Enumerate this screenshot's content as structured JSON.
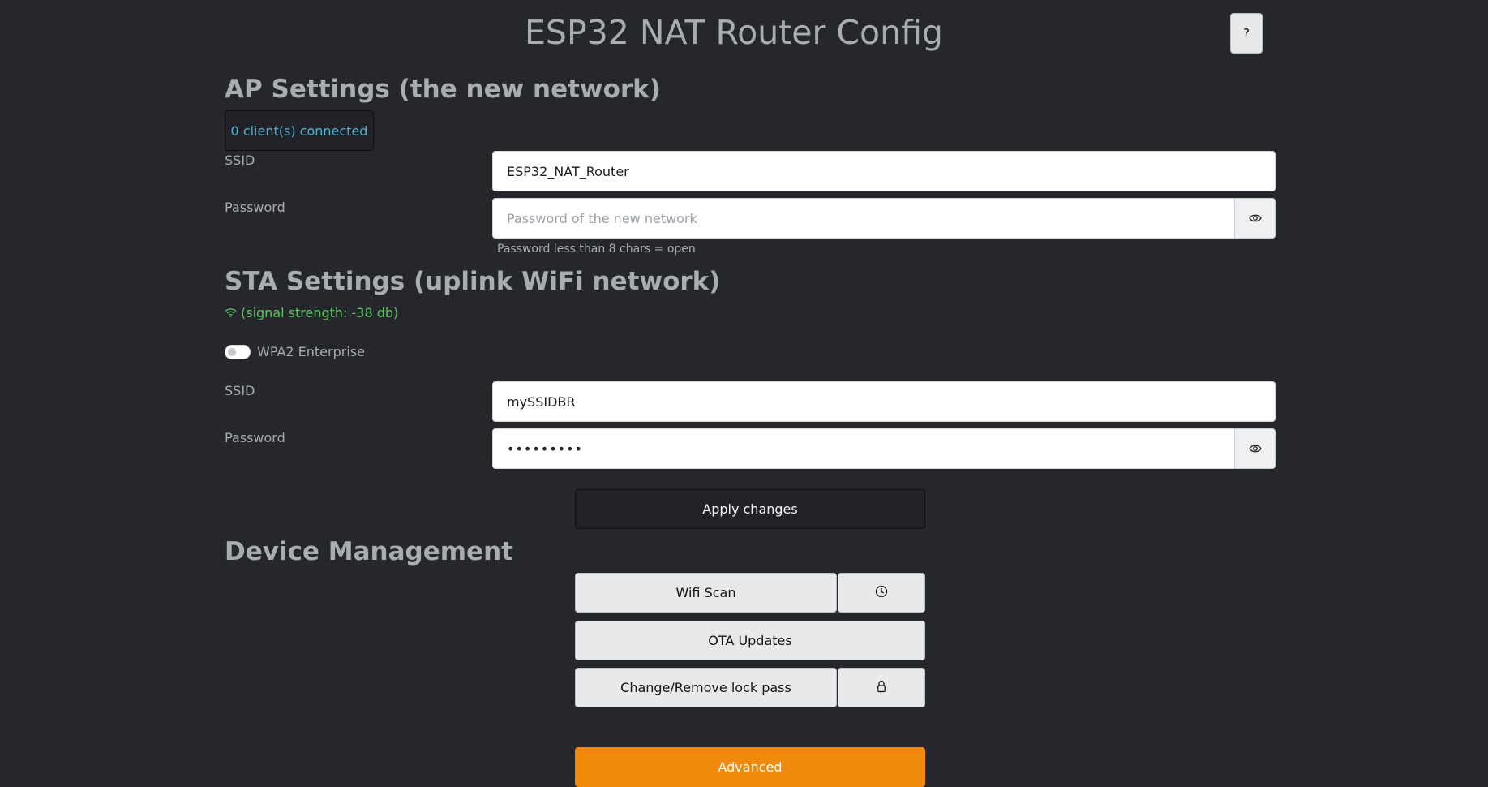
{
  "header": {
    "title": "ESP32 NAT Router Config",
    "help_label": "?"
  },
  "ap": {
    "heading": "AP Settings (the new network)",
    "clients_badge": "0 client(s) connected",
    "ssid_label": "SSID",
    "ssid_value": "ESP32_NAT_Router",
    "password_label": "Password",
    "password_value": "",
    "password_placeholder": "Password of the new network",
    "password_hint": "Password less than 8 chars = open"
  },
  "sta": {
    "heading": "STA Settings (uplink WiFi network)",
    "signal_text": "(signal strength: -38 db)",
    "enterprise_label": "WPA2 Enterprise",
    "enterprise_enabled": false,
    "ssid_label": "SSID",
    "ssid_value": "mySSIDBR",
    "password_label": "Password",
    "password_value": "•••••••••"
  },
  "apply_label": "Apply changes",
  "device": {
    "heading": "Device Management",
    "wifi_scan_label": "Wifi Scan",
    "ota_label": "OTA Updates",
    "lock_label": "Change/Remove lock pass",
    "advanced_label": "Advanced"
  },
  "colors": {
    "background": "#25272c",
    "signal_green": "#5bc660",
    "badge_blue": "#4fb0cf",
    "advanced_orange": "#f08a0c"
  },
  "icons": {
    "eye": "eye-icon",
    "clock": "clock-icon",
    "lock": "lock-icon",
    "wifi": "wifi-icon"
  }
}
